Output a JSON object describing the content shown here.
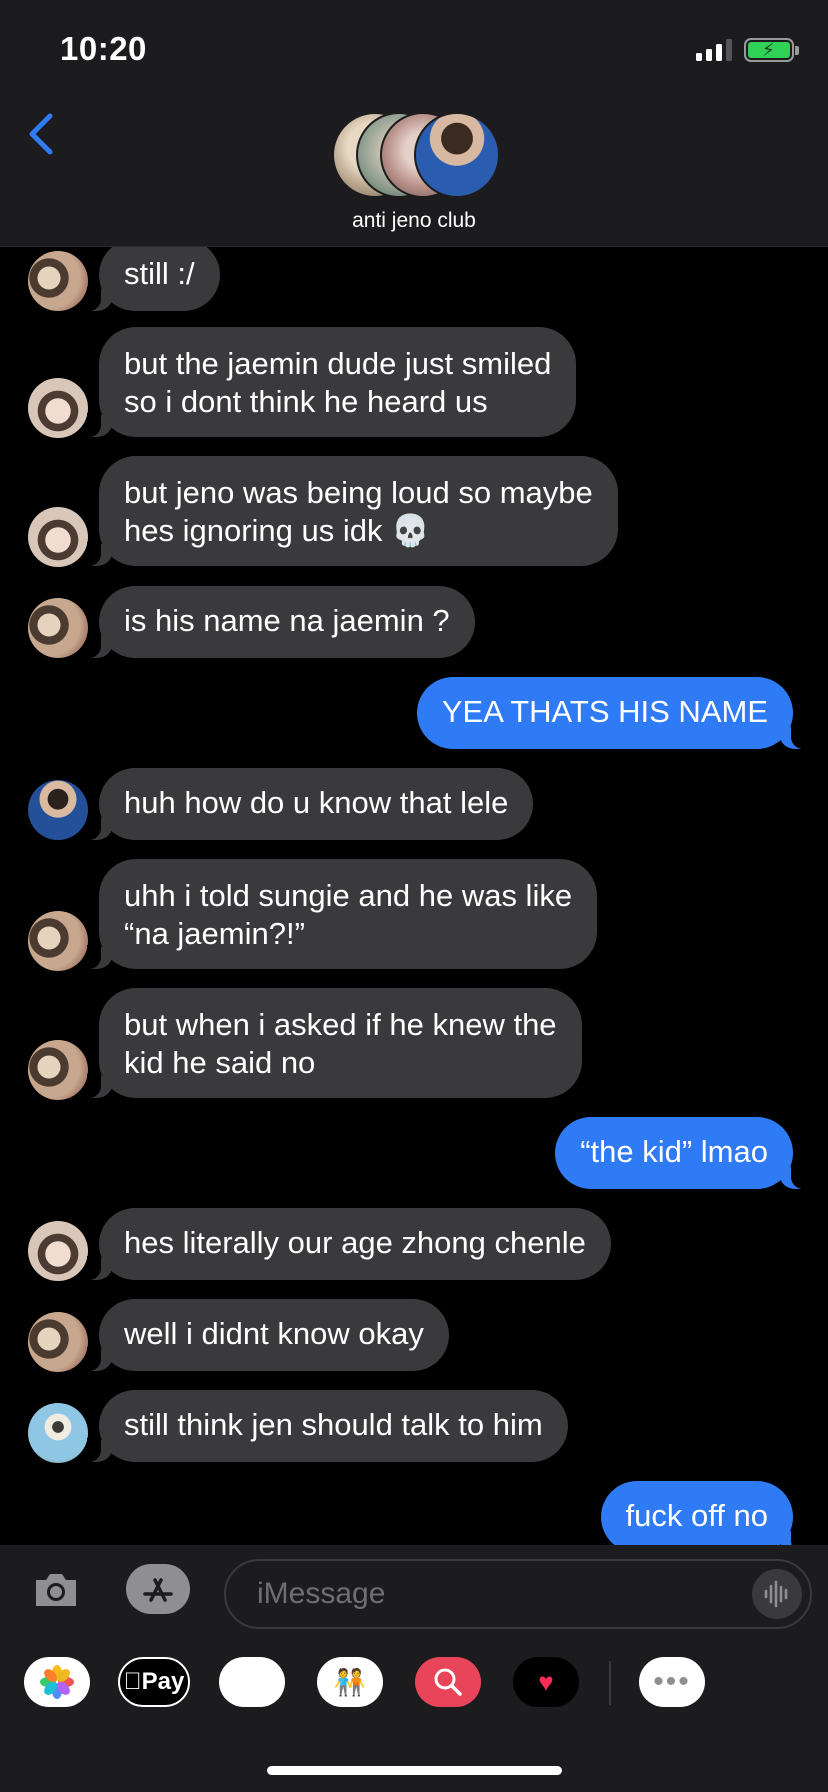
{
  "status_bar": {
    "time": "10:20"
  },
  "header": {
    "group_name": "anti jeno club"
  },
  "messages": [
    {
      "side": "in",
      "text": "still :/",
      "avatar": "pair"
    },
    {
      "side": "in",
      "text": "but the jaemin dude just smiled\nso i dont think he heard us",
      "avatar": "boy"
    },
    {
      "side": "in",
      "text": "but jeno was being loud so maybe\nhes ignoring us idk 💀",
      "avatar": "boy"
    },
    {
      "side": "in",
      "text": "is his name na jaemin ?",
      "avatar": "pair"
    },
    {
      "side": "out",
      "text": "YEA THATS HIS NAME"
    },
    {
      "side": "in",
      "text": "huh how do u know that lele",
      "avatar": "blue"
    },
    {
      "side": "in",
      "text": "uhh i told sungie and he was like\n“na jaemin?!”",
      "avatar": "pair"
    },
    {
      "side": "in",
      "text": "but when i asked if he knew the\nkid he said no",
      "avatar": "pair"
    },
    {
      "side": "out",
      "text": "“the kid” lmao"
    },
    {
      "side": "in",
      "text": "hes literally our age zhong chenle",
      "avatar": "boy"
    },
    {
      "side": "in",
      "text": "well i didnt know okay",
      "avatar": "pair"
    },
    {
      "side": "in",
      "text": "still think jen should talk to him",
      "avatar": "sky"
    },
    {
      "side": "out",
      "text": "fuck off no"
    }
  ],
  "input": {
    "placeholder": "iMessage"
  },
  "app_drawer": [
    {
      "name": "photos-app-icon",
      "label": ""
    },
    {
      "name": "apple-pay-icon",
      "label": "Pay"
    },
    {
      "name": "animoji-icon",
      "label": ""
    },
    {
      "name": "memoji-icon",
      "label": ""
    },
    {
      "name": "image-search-icon",
      "label": ""
    },
    {
      "name": "digital-touch-icon",
      "label": ""
    },
    {
      "name": "more-apps-icon",
      "label": ""
    }
  ],
  "colors": {
    "incoming_bubble": "#3a3a3c",
    "outgoing_bubble": "#2f7bf6",
    "accent": "#2f7bf6",
    "bar_background": "#1c1c1e"
  }
}
